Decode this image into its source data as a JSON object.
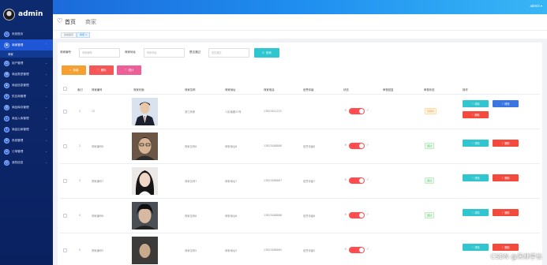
{
  "topbar": {
    "user": "admin"
  },
  "brand": {
    "name": "admin"
  },
  "sidebar": {
    "items": [
      {
        "label": "系统首页",
        "icon": "home-icon"
      },
      {
        "label": "商家管理",
        "icon": "shop-icon",
        "active": true
      },
      {
        "label": "用户管理",
        "icon": "user-icon"
      },
      {
        "label": "商品类型管理",
        "icon": "category-icon"
      },
      {
        "label": "商品信息管理",
        "icon": "goods-icon"
      },
      {
        "label": "供应商管理",
        "icon": "supplier-icon"
      },
      {
        "label": "商品库存管理",
        "icon": "stock-icon"
      },
      {
        "label": "商品入库管理",
        "icon": "inbound-icon"
      },
      {
        "label": "商品出库管理",
        "icon": "outbound-icon"
      },
      {
        "label": "系统管理",
        "icon": "settings-icon"
      },
      {
        "label": "订单管理",
        "icon": "order-icon"
      },
      {
        "label": "我的信息",
        "icon": "profile-icon"
      }
    ],
    "sub_item": "商家"
  },
  "header": {
    "home": "首页",
    "current": "商家"
  },
  "tabs": [
    {
      "label": "系统首页"
    },
    {
      "label": "商家 ×"
    }
  ],
  "search": {
    "merchant_no_label": "商家编号",
    "merchant_no_placeholder": "商家编号",
    "merchant_addr_label": "商家地址",
    "merchant_addr_placeholder": "商家地址",
    "approved_label": "是否通过",
    "approved_placeholder": "是否通过",
    "query_button": "查询"
  },
  "actions": {
    "add": "新增",
    "delete": "删除",
    "stats": "统计"
  },
  "table": {
    "headers": [
      "索引",
      "商家编号",
      "商家封面",
      "商家名称",
      "商家地址",
      "商家电话",
      "信誉评级",
      "状态",
      "审核回复",
      "审核状态",
      "操作"
    ],
    "rows": [
      {
        "index": "1",
        "merchant_no": "12",
        "name": "浙江商家",
        "address": "人民南路53号",
        "phone": "13823622222",
        "rating": "",
        "review_reply": "",
        "audit": "待审核",
        "audit_type": "pending"
      },
      {
        "index": "2",
        "merchant_no": "商家编号8",
        "name": "商家名称8",
        "address": "商家地址8",
        "phone": "13823888888",
        "rating": "信誉评级8",
        "review_reply": "",
        "audit": "通过",
        "audit_type": "passed"
      },
      {
        "index": "3",
        "merchant_no": "商家编号7",
        "name": "商家名称7",
        "address": "商家地址7",
        "phone": "13823888887",
        "rating": "信誉评级7",
        "review_reply": "",
        "audit": "通过",
        "audit_type": "passed"
      },
      {
        "index": "4",
        "merchant_no": "商家编号6",
        "name": "商家名称6",
        "address": "商家地址6",
        "phone": "13823888886",
        "rating": "信誉评级6",
        "review_reply": "",
        "audit": "通过",
        "audit_type": "passed"
      },
      {
        "index": "5",
        "merchant_no": "商家编号5",
        "name": "商家名称5",
        "address": "商家地址5",
        "phone": "13823888885",
        "rating": "信誉评级5",
        "review_reply": "",
        "audit": "",
        "audit_type": ""
      }
    ],
    "op_detail": "♡ 详情",
    "op_edit": "♡ 修改",
    "op_remove": "♡ 删除"
  },
  "watermark": "CSDN @禾林学长"
}
